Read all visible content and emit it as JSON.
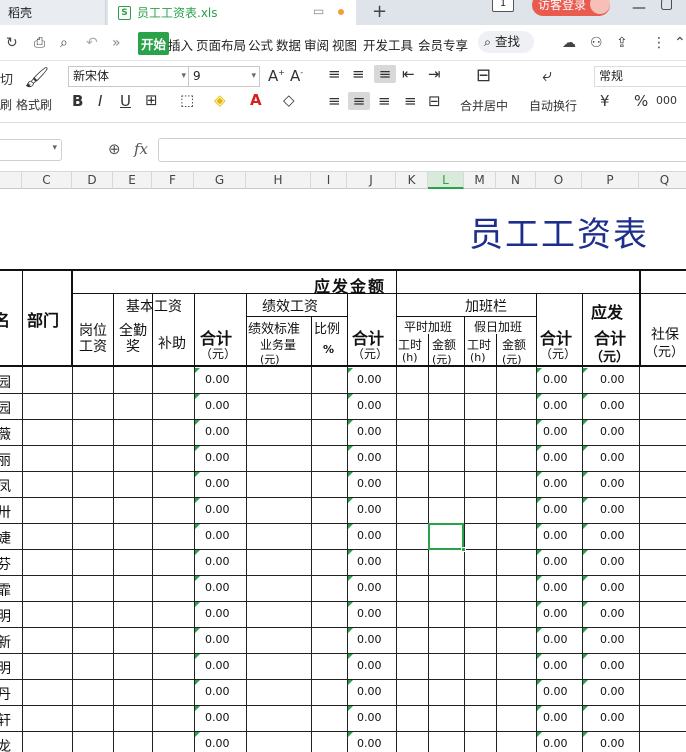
{
  "tabs": {
    "tab1_label": "稻壳",
    "tab2_label": "员工工资表.xls",
    "new_tab": "+",
    "login_label": "访客登录",
    "page_count": "1"
  },
  "menu": {
    "start": "开始",
    "items": [
      "插入",
      "页面布局",
      "公式",
      "数据",
      "审阅",
      "视图",
      "开发工具",
      "会员专享"
    ],
    "search": "查找"
  },
  "ribbon": {
    "font_name": "新宋体",
    "font_size": "9",
    "format_painter": "格式刷",
    "paste": "刷",
    "cut": "切",
    "merge_center": "合并居中",
    "wrap_text": "自动换行",
    "number_format": "常规",
    "currency": "¥",
    "percent": "%",
    "thousands": "000"
  },
  "formula_bar": {
    "fx": "fx"
  },
  "columns": [
    "C",
    "D",
    "E",
    "F",
    "G",
    "H",
    "I",
    "J",
    "K",
    "L",
    "M",
    "N",
    "O",
    "P",
    "Q"
  ],
  "sheet": {
    "title": "员工工资表",
    "h_name": "名",
    "h_dept": "部门",
    "h_payable": "应发金额",
    "h_basic": "基本工资",
    "h_post": "岗位工资",
    "h_attend": "全勤奖",
    "h_allow": "补助",
    "h_sum": "合计",
    "h_yuan": "（元）",
    "h_perf": "绩效工资",
    "h_perf_std": "绩效标准",
    "h_ratio": "比例",
    "h_biz": "业务量",
    "h_pct": "%",
    "h_ot": "加班栏",
    "h_ot_normal": "平时加班",
    "h_ot_holiday": "假日加班",
    "h_hours": "工时",
    "h_h": "(h)",
    "h_amount": "金额",
    "h_yuan_s": "(元)",
    "h_payable_total1": "应发",
    "h_payable_total2": "合计",
    "h_social": "社保",
    "names": [
      "园",
      "园",
      "薇",
      "丽",
      "凤",
      "卅",
      "婕",
      "芬",
      "霏",
      "明",
      "新",
      "明",
      "丹",
      "轩",
      "龙"
    ],
    "zero": "0.00"
  }
}
